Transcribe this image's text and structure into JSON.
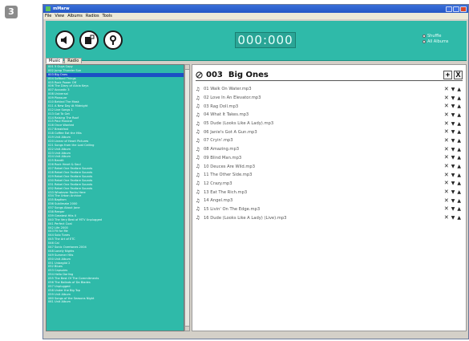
{
  "step_badge": "3",
  "window": {
    "title": "mMarw",
    "menu": [
      "File",
      "View",
      "Albums",
      "Radios",
      "Tools"
    ]
  },
  "toolbar": {
    "buttons": [
      {
        "name": "mute-button",
        "icon": "speaker-icon"
      },
      {
        "name": "add-playlist-button",
        "icon": "add-note-icon"
      },
      {
        "name": "settings-button",
        "icon": "wrench-icon"
      }
    ],
    "counter": "000:000",
    "radios": [
      {
        "label": "Shuffle",
        "selected": false
      },
      {
        "label": "All Albums",
        "selected": false
      }
    ]
  },
  "tabs": [
    {
      "label": "Music",
      "active": true
    },
    {
      "label": "Radio",
      "active": false
    }
  ],
  "playlist": {
    "number": "003",
    "name": "Big Ones",
    "add_label": "+",
    "close_label": "X",
    "tracks": [
      "01 Walk On Water.mp3",
      "02 Love In An Elevator.mp3",
      "03 Rag Doll.mp3",
      "04 What It Takes.mp3",
      "05 Dude (Looks Like A Lady).mp3",
      "06 Janie's Got A Gun.mp3",
      "07 Cryin'.mp3",
      "08 Amazing.mp3",
      "09 Blind Man.mp3",
      "10 Deuces Are Wild.mp3",
      "11 The Other Side.mp3",
      "12 Crazy.mp3",
      "13 Eat The Rich.mp3",
      "14 Angel.mp3",
      "15 Livin' On The Edge.mp3",
      "16 Dude (Looks Like A Lady) (Live).mp3"
    ]
  },
  "album_list": {
    "selected_index": 2,
    "items": [
      "001  5 Guys Copy",
      "002  Jump Thunder Sun",
      "003  Big Ones",
      "004  Softball Things",
      "005  Rock Power Off",
      "006  The Diary of Alicia Keys",
      "007  Acoustic 3",
      "008  Universal",
      "009  Pleasure",
      "010  Behind The Mask",
      "011  A New Day At Midnight",
      "012  Live Songs 1",
      "013  Got Ta Get",
      "014  Raising The Roof",
      "015  Paul Musical",
      "016  Once Wanted",
      "017  Breakfast",
      "018  Coffee Eat the Hits",
      "019  Unit Album",
      "020  Linear of Heart Pictures",
      "021  Songs from the Lost Ceiling",
      "022  Unit Album",
      "023  Unit Album",
      "024  Unit Album",
      "025  Bandit",
      "026  Rock Heart & Soul",
      "027  Rebel One Fanfare Sounds",
      "028  Rebel One Fanfare Sounds",
      "029  Rebel One Fanfare Sounds",
      "030  Rebel One Fanfare Sounds",
      "031  Rebel One Fanfare Sounds",
      "032  Rebel One Fanfare Sounds",
      "033  Whatever Rocks Here",
      "034  The Urban Archive",
      "035  Baptism",
      "036  Sublimate 2000",
      "037  Songs About Jane",
      "038  Reeper",
      "039  Greatest Hits II",
      "040  The Very Best of MTV Unplugged",
      "041  Perfect Coal",
      "042  Life 2000",
      "043  Fit for Me",
      "044  Solo Tunes",
      "045  The Art of ETC",
      "046  Cal",
      "047  Sonic Overtones 2004",
      "048  Lonely Nights",
      "049  Summer Hits",
      "050  Unit Album",
      "051  Unbeglid 2",
      "052  Blues",
      "053  Capsules",
      "054  Hello Darling",
      "055  The Best Of The Commitments",
      "056  The Ballads of Da Blades",
      "057  Unplugged",
      "058  Under the Big Top",
      "059  Unit Album",
      "060  Songs of the Seasons Night",
      "061  Unit Album"
    ]
  },
  "colors": {
    "accent": "#2fbaa9",
    "selection": "#1b4fc4"
  }
}
